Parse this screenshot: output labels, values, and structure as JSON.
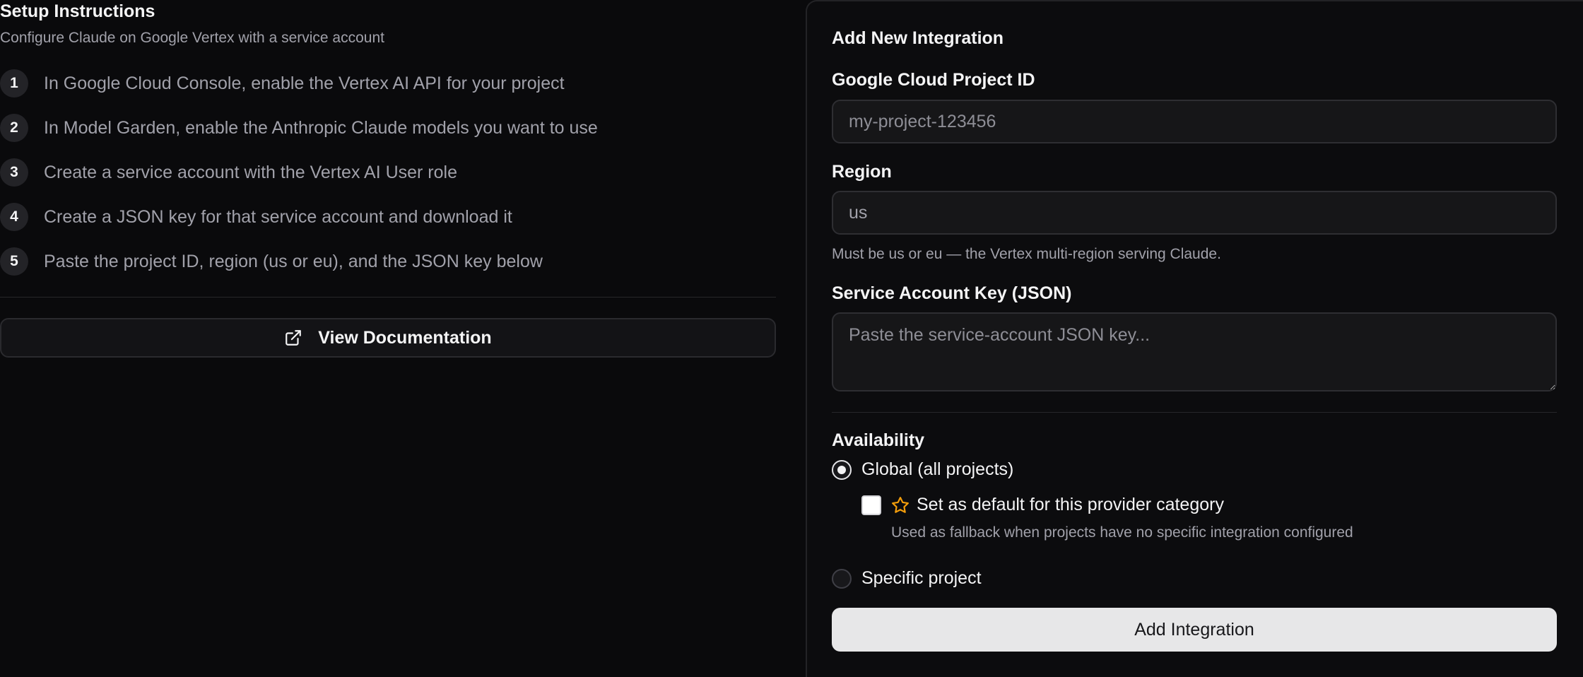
{
  "setup": {
    "title": "Setup Instructions",
    "subtitle": "Configure Claude on Google Vertex with a service account",
    "steps": [
      {
        "num": "1",
        "text": "In Google Cloud Console, enable the Vertex AI API for your project"
      },
      {
        "num": "2",
        "text": "In Model Garden, enable the Anthropic Claude models you want to use"
      },
      {
        "num": "3",
        "text": "Create a service account with the Vertex AI User role"
      },
      {
        "num": "4",
        "text": "Create a JSON key for that service account and download it"
      },
      {
        "num": "5",
        "text": "Paste the project ID, region (us or eu), and the JSON key below"
      }
    ],
    "doc_button_label": "View Documentation",
    "doc_button_icon": "external-link-icon"
  },
  "form": {
    "title": "Add New Integration",
    "project_id": {
      "label": "Google Cloud Project ID",
      "placeholder": "my-project-123456",
      "value": ""
    },
    "region": {
      "label": "Region",
      "value": "us",
      "hint": "Must be us or eu — the Vertex multi-region serving Claude."
    },
    "service_key": {
      "label": "Service Account Key (JSON)",
      "placeholder": "Paste the service-account JSON key...",
      "value": ""
    },
    "availability": {
      "label": "Availability",
      "options": [
        {
          "label": "Global (all projects)",
          "selected": true
        },
        {
          "label": "Specific project",
          "selected": false
        }
      ],
      "default_checkbox": {
        "label": "Set as default for this provider category",
        "hint": "Used as fallback when projects have no specific integration configured",
        "checked": false,
        "icon": "star-icon",
        "icon_color": "#f59e0b"
      }
    },
    "submit_label": "Add Integration"
  }
}
